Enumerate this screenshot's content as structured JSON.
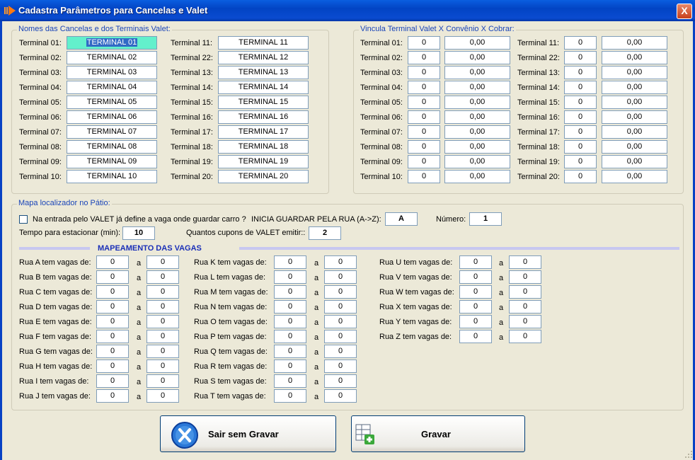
{
  "window": {
    "title": "Cadastra Parâmetros para Cancelas e Valet",
    "close_label": "X"
  },
  "terminals_group": {
    "title": "Nomes das Cancelas e dos Terminais Valet:",
    "left": [
      {
        "label": "Terminal 01:",
        "value": "TERMINAL 01"
      },
      {
        "label": "Terminal 02:",
        "value": "TERMINAL 02"
      },
      {
        "label": "Terminal 03:",
        "value": "TERMINAL 03"
      },
      {
        "label": "Terminal 04:",
        "value": "TERMINAL 04"
      },
      {
        "label": "Terminal 05:",
        "value": "TERMINAL 05"
      },
      {
        "label": "Terminal 06:",
        "value": "TERMINAL 06"
      },
      {
        "label": "Terminal 07:",
        "value": "TERMINAL 07"
      },
      {
        "label": "Terminal 08:",
        "value": "TERMINAL 08"
      },
      {
        "label": "Terminal 09:",
        "value": "TERMINAL 09"
      },
      {
        "label": "Terminal 10:",
        "value": "TERMINAL 10"
      }
    ],
    "right": [
      {
        "label": "Terminal 11:",
        "value": "TERMINAL 11"
      },
      {
        "label": "Terminal 22:",
        "value": "TERMINAL 12"
      },
      {
        "label": "Terminal 13:",
        "value": "TERMINAL 13"
      },
      {
        "label": "Terminal 14:",
        "value": "TERMINAL 14"
      },
      {
        "label": "Terminal 15:",
        "value": "TERMINAL 15"
      },
      {
        "label": "Terminal 16:",
        "value": "TERMINAL 16"
      },
      {
        "label": "Terminal 17:",
        "value": "TERMINAL 17"
      },
      {
        "label": "Terminal 18:",
        "value": "TERMINAL 18"
      },
      {
        "label": "Terminal 19:",
        "value": "TERMINAL 19"
      },
      {
        "label": "Terminal 20:",
        "value": "TERMINAL 20"
      }
    ]
  },
  "vinculo_group": {
    "title": "Vincula Terminal Valet X Convênio X Cobrar:",
    "left": [
      {
        "label": "Terminal 01:",
        "convenio": "0",
        "cobrar": "0,00"
      },
      {
        "label": "Terminal 02:",
        "convenio": "0",
        "cobrar": "0,00"
      },
      {
        "label": "Terminal 03:",
        "convenio": "0",
        "cobrar": "0,00"
      },
      {
        "label": "Terminal 04:",
        "convenio": "0",
        "cobrar": "0,00"
      },
      {
        "label": "Terminal 05:",
        "convenio": "0",
        "cobrar": "0,00"
      },
      {
        "label": "Terminal 06:",
        "convenio": "0",
        "cobrar": "0,00"
      },
      {
        "label": "Terminal 07:",
        "convenio": "0",
        "cobrar": "0,00"
      },
      {
        "label": "Terminal 08:",
        "convenio": "0",
        "cobrar": "0,00"
      },
      {
        "label": "Terminal 09:",
        "convenio": "0",
        "cobrar": "0,00"
      },
      {
        "label": "Terminal 10:",
        "convenio": "0",
        "cobrar": "0,00"
      }
    ],
    "right": [
      {
        "label": "Terminal 11:",
        "convenio": "0",
        "cobrar": "0,00"
      },
      {
        "label": "Terminal 22:",
        "convenio": "0",
        "cobrar": "0,00"
      },
      {
        "label": "Terminal 13:",
        "convenio": "0",
        "cobrar": "0,00"
      },
      {
        "label": "Terminal 14:",
        "convenio": "0",
        "cobrar": "0,00"
      },
      {
        "label": "Terminal 15:",
        "convenio": "0",
        "cobrar": "0,00"
      },
      {
        "label": "Terminal 16:",
        "convenio": "0",
        "cobrar": "0,00"
      },
      {
        "label": "Terminal 17:",
        "convenio": "0",
        "cobrar": "0,00"
      },
      {
        "label": "Terminal 18:",
        "convenio": "0",
        "cobrar": "0,00"
      },
      {
        "label": "Terminal 19:",
        "convenio": "0",
        "cobrar": "0,00"
      },
      {
        "label": "Terminal 20:",
        "convenio": "0",
        "cobrar": "0,00"
      }
    ]
  },
  "mapa_group": {
    "title": "Mapa localizador no Pátio:",
    "checkbox_label": "Na entrada pelo VALET já define a vaga onde guardar carro ?",
    "checkbox_checked": false,
    "inicia_label": "INICIA GUARDAR PELA RUA (A->Z):",
    "inicia_value": "A",
    "numero_label": "Número:",
    "numero_value": "1",
    "tempo_label": "Tempo para estacionar (min):",
    "tempo_value": "10",
    "cupons_label": "Quantos cupons de VALET emitir::",
    "cupons_value": "2",
    "mapeamento_title": "MAPEAMENTO DAS VAGAS",
    "a_label": "a",
    "ruas": [
      {
        "label": "Rua A tem vagas de:",
        "from": "0",
        "to": "0"
      },
      {
        "label": "Rua B tem vagas de:",
        "from": "0",
        "to": "0"
      },
      {
        "label": "Rua C tem vagas de:",
        "from": "0",
        "to": "0"
      },
      {
        "label": "Rua D tem vagas de:",
        "from": "0",
        "to": "0"
      },
      {
        "label": "Rua E tem vagas de:",
        "from": "0",
        "to": "0"
      },
      {
        "label": "Rua F tem vagas de:",
        "from": "0",
        "to": "0"
      },
      {
        "label": "Rua G tem vagas de:",
        "from": "0",
        "to": "0"
      },
      {
        "label": "Rua H tem vagas de:",
        "from": "0",
        "to": "0"
      },
      {
        "label": "Rua I tem vagas de:",
        "from": "0",
        "to": "0"
      },
      {
        "label": "Rua J tem vagas de:",
        "from": "0",
        "to": "0"
      },
      {
        "label": "Rua K tem vagas de:",
        "from": "0",
        "to": "0"
      },
      {
        "label": "Rua L tem vagas de:",
        "from": "0",
        "to": "0"
      },
      {
        "label": "Rua M tem vagas de:",
        "from": "0",
        "to": "0"
      },
      {
        "label": "Rua N tem vagas de:",
        "from": "0",
        "to": "0"
      },
      {
        "label": "Rua O tem vagas de:",
        "from": "0",
        "to": "0"
      },
      {
        "label": "Rua P tem vagas de:",
        "from": "0",
        "to": "0"
      },
      {
        "label": "Rua Q tem vagas de:",
        "from": "0",
        "to": "0"
      },
      {
        "label": "Rua R tem vagas de:",
        "from": "0",
        "to": "0"
      },
      {
        "label": "Rua S tem vagas de:",
        "from": "0",
        "to": "0"
      },
      {
        "label": "Rua T tem vagas de:",
        "from": "0",
        "to": "0"
      },
      {
        "label": "Rua U tem vagas de:",
        "from": "0",
        "to": "0"
      },
      {
        "label": "Rua V tem vagas de:",
        "from": "0",
        "to": "0"
      },
      {
        "label": "Rua W tem vagas de:",
        "from": "0",
        "to": "0"
      },
      {
        "label": "Rua X tem vagas de:",
        "from": "0",
        "to": "0"
      },
      {
        "label": "Rua Y tem vagas de:",
        "from": "0",
        "to": "0"
      },
      {
        "label": "Rua Z tem vagas de:",
        "from": "0",
        "to": "0"
      }
    ]
  },
  "buttons": {
    "exit_label": "Sair sem Gravar",
    "save_label": "Gravar"
  },
  "icons": {
    "title": "arrow-icon",
    "exit": "x-circle-icon",
    "save": "grid-plus-icon"
  }
}
